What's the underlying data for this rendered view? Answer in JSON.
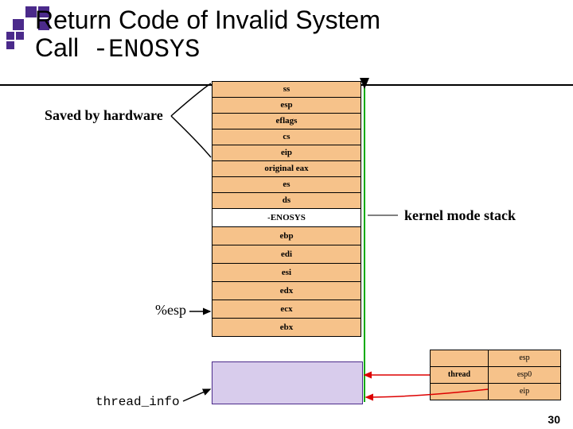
{
  "title_part1": "Return Code of Invalid System",
  "title_part2": "Call",
  "title_code": "-ENOSYS",
  "labels": {
    "saved": "Saved by hardware",
    "esp": "%esp",
    "kernel_stack": "kernel mode stack",
    "thread_info": "thread_info"
  },
  "stack": [
    "ss",
    "esp",
    "eflags",
    "cs",
    "eip",
    "original eax",
    "es",
    "ds",
    "-ENOSYS",
    "ebp",
    "edi",
    "esi",
    "edx",
    "ecx",
    "ebx"
  ],
  "mini_table": {
    "left": "thread",
    "right": [
      "esp",
      "esp0",
      "eip"
    ]
  },
  "page_num": "30"
}
